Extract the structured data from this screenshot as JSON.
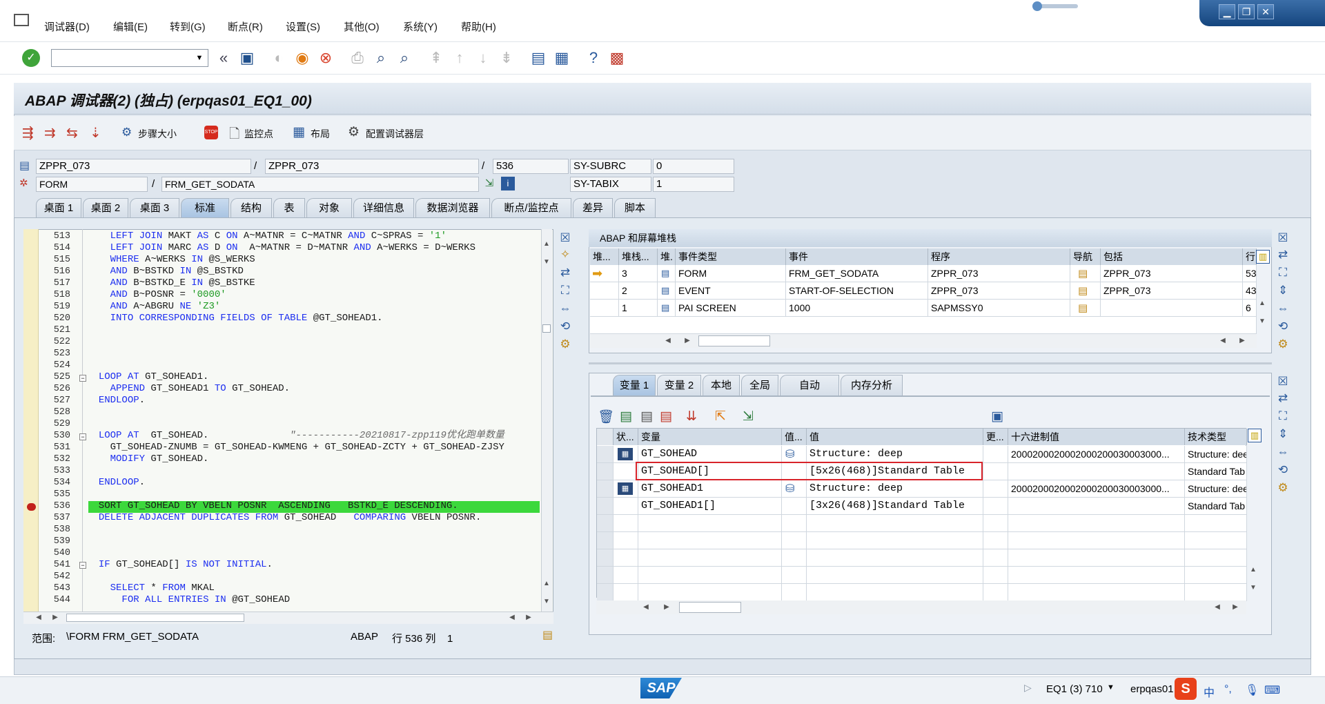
{
  "menu": [
    "调试器(D)",
    "编辑(E)",
    "转到(G)",
    "断点(R)",
    "设置(S)",
    "其他(O)",
    "系统(Y)",
    "帮助(H)"
  ],
  "window": {
    "minimize": "▁",
    "restore": "❐",
    "close": "✕"
  },
  "toolbar": {
    "command_field": ""
  },
  "app_title": "ABAP 调试器(2)  (独占) (erpqas01_EQ1_00)",
  "app_toolbar": {
    "step_size": "步骤大小",
    "watchpoint": "监控点",
    "layout": "布局",
    "configure": "配置调试器层"
  },
  "header_fields": {
    "program1": "ZPPR_073",
    "program2": "ZPPR_073",
    "line": "536",
    "sy_subrc_label": "SY-SUBRC",
    "sy_subrc_value": "0",
    "event_type": "FORM",
    "event": "FRM_GET_SODATA",
    "sy_tabix_label": "SY-TABIX",
    "sy_tabix_value": "1",
    "sep1": "/",
    "sep2": "/",
    "sep3": "/"
  },
  "tabs": [
    "桌面 1",
    "桌面 2",
    "桌面 3",
    "标准",
    "结构",
    "表",
    "对象",
    "详细信息",
    "数据浏览器",
    "断点/监控点",
    "差异",
    "脚本"
  ],
  "code": {
    "lines": [
      {
        "n": "513",
        "t": "    LEFT JOIN MAKT AS C ON A~MATNR = C~MATNR AND C~SPRAS = '1'"
      },
      {
        "n": "514",
        "t": "    LEFT JOIN MARC AS D ON  A~MATNR = D~MATNR AND A~WERKS = D~WERKS"
      },
      {
        "n": "515",
        "t": "    WHERE A~WERKS IN @S_WERKS"
      },
      {
        "n": "516",
        "t": "    AND B~BSTKD IN @S_BSTKD"
      },
      {
        "n": "517",
        "t": "    AND B~BSTKD_E IN @S_BSTKE"
      },
      {
        "n": "518",
        "t": "    AND B~POSNR = '0000'"
      },
      {
        "n": "519",
        "t": "    AND A~ABGRU NE 'Z3'"
      },
      {
        "n": "520",
        "t": "    INTO CORRESPONDING FIELDS OF TABLE @GT_SOHEAD1."
      },
      {
        "n": "521",
        "t": ""
      },
      {
        "n": "522",
        "t": ""
      },
      {
        "n": "523",
        "t": ""
      },
      {
        "n": "524",
        "t": ""
      },
      {
        "n": "525",
        "t": "  LOOP AT GT_SOHEAD1."
      },
      {
        "n": "526",
        "t": "    APPEND GT_SOHEAD1 TO GT_SOHEAD."
      },
      {
        "n": "527",
        "t": "  ENDLOOP."
      },
      {
        "n": "528",
        "t": ""
      },
      {
        "n": "529",
        "t": ""
      },
      {
        "n": "530",
        "t": "  LOOP AT  GT_SOHEAD.              \"-----------20210817-zpp119优化跑单数量"
      },
      {
        "n": "531",
        "t": "    GT_SOHEAD-ZNUMB = GT_SOHEAD-KWMENG + GT_SOHEAD-ZCTY + GT_SOHEAD-ZJSY"
      },
      {
        "n": "532",
        "t": "    MODIFY GT_SOHEAD."
      },
      {
        "n": "533",
        "t": ""
      },
      {
        "n": "534",
        "t": "  ENDLOOP."
      },
      {
        "n": "535",
        "t": ""
      },
      {
        "n": "536",
        "t": "  SORT GT_SOHEAD BY VBELN POSNR  ASCENDING   BSTKD_E DESCENDING."
      },
      {
        "n": "537",
        "t": "  DELETE ADJACENT DUPLICATES FROM GT_SOHEAD   COMPARING VBELN POSNR."
      },
      {
        "n": "538",
        "t": ""
      },
      {
        "n": "539",
        "t": ""
      },
      {
        "n": "540",
        "t": ""
      },
      {
        "n": "541",
        "t": "  IF GT_SOHEAD[] IS NOT INITIAL."
      },
      {
        "n": "542",
        "t": ""
      },
      {
        "n": "543",
        "t": "    SELECT * FROM MKAL"
      },
      {
        "n": "544",
        "t": "      FOR ALL ENTRIES IN @GT_SOHEAD"
      }
    ],
    "status_scope_label": "范围:",
    "status_scope": "\\FORM FRM_GET_SODATA",
    "status_lang": "ABAP",
    "status_pos": "行 536 列    1"
  },
  "stack": {
    "title": "ABAP 和屏幕堆栈",
    "headers": [
      "堆...",
      "堆栈...",
      "堆.",
      "事件类型",
      "事件",
      "程序",
      "导航",
      "包括",
      "行"
    ],
    "rows": [
      {
        "level": "3",
        "type": "FORM",
        "event": "FRM_GET_SODATA",
        "program": "ZPPR_073",
        "include": "ZPPR_073",
        "line": "53"
      },
      {
        "level": "2",
        "type": "EVENT",
        "event": "START-OF-SELECTION",
        "program": "ZPPR_073",
        "include": "ZPPR_073",
        "line": "43"
      },
      {
        "level": "1",
        "type": "PAI SCREEN",
        "event": "1000",
        "program": "SAPMSSY0",
        "include": "",
        "line": "6"
      }
    ]
  },
  "var_tabs": [
    "变量 1",
    "变量 2",
    "本地",
    "全局",
    "自动",
    "内存分析"
  ],
  "vars": {
    "headers": [
      "状...",
      "变量",
      "值...",
      "值",
      "更...",
      "十六进制值",
      "技术类型"
    ],
    "rows": [
      {
        "name": "GT_SOHEAD",
        "value": "Structure: deep",
        "hex": "2000200020002000200030003000...",
        "tech": "Structure: dee"
      },
      {
        "name": "GT_SOHEAD[]",
        "value": "[5x26(468)]Standard Table",
        "hex": "",
        "tech": "Standard Tab"
      },
      {
        "name": "GT_SOHEAD1",
        "value": "Structure: deep",
        "hex": "2000200020002000200030003000...",
        "tech": "Structure: dee"
      },
      {
        "name": "GT_SOHEAD1[]",
        "value": "[3x26(468)]Standard Table",
        "hex": "",
        "tech": "Standard Tab"
      }
    ]
  },
  "statusbar": {
    "logo": "SAP",
    "system": "EQ1 (3) 710",
    "server": "erpqas01",
    "ime": "中",
    "ime2": "°,"
  }
}
